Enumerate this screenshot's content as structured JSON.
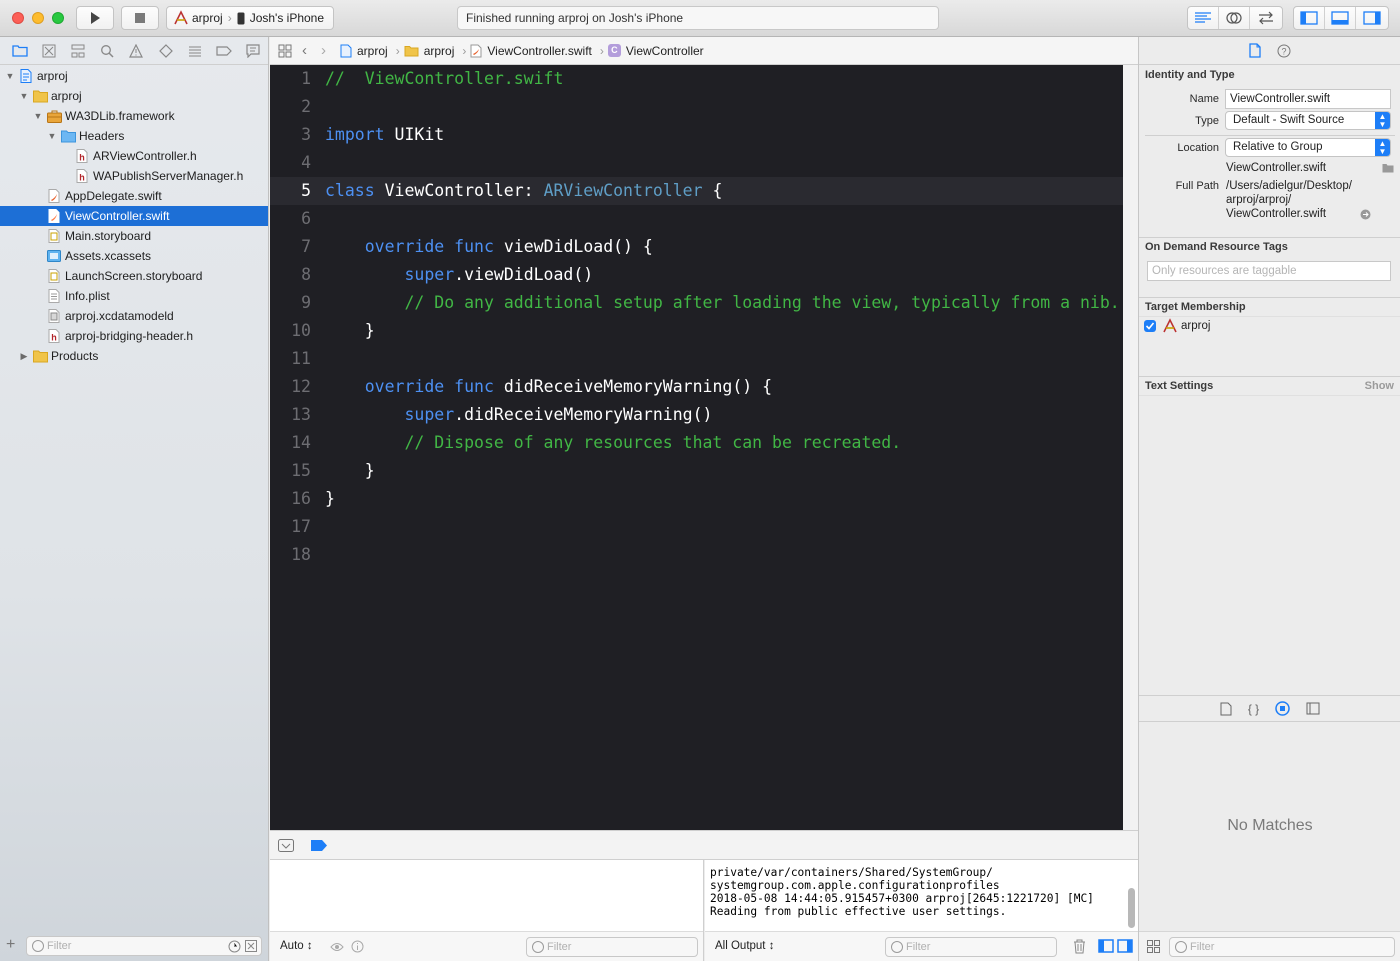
{
  "toolbar": {
    "scheme_name": "arproj",
    "device_name": "Josh's iPhone",
    "activity_status": "Finished running arproj on Josh's iPhone"
  },
  "navigator": {
    "tree": [
      {
        "label": "arproj",
        "icon": "project-icon",
        "level": 0,
        "disclosure": "open",
        "selected": false
      },
      {
        "label": "arproj",
        "icon": "folder-icon",
        "level": 1,
        "disclosure": "open",
        "selected": false
      },
      {
        "label": "WA3DLib.framework",
        "icon": "framework-icon",
        "level": 2,
        "disclosure": "open",
        "selected": false
      },
      {
        "label": "Headers",
        "icon": "blue-folder-icon",
        "level": 3,
        "disclosure": "open",
        "selected": false
      },
      {
        "label": "ARViewController.h",
        "icon": "header-file-icon",
        "level": 4,
        "disclosure": "none",
        "selected": false
      },
      {
        "label": "WAPublishServerManager.h",
        "icon": "header-file-icon",
        "level": 4,
        "disclosure": "none",
        "selected": false
      },
      {
        "label": "AppDelegate.swift",
        "icon": "swift-file-icon",
        "level": 2,
        "disclosure": "none",
        "selected": false
      },
      {
        "label": "ViewController.swift",
        "icon": "swift-file-icon",
        "level": 2,
        "disclosure": "none",
        "selected": true
      },
      {
        "label": "Main.storyboard",
        "icon": "storyboard-icon",
        "level": 2,
        "disclosure": "none",
        "selected": false
      },
      {
        "label": "Assets.xcassets",
        "icon": "assets-icon",
        "level": 2,
        "disclosure": "none",
        "selected": false
      },
      {
        "label": "LaunchScreen.storyboard",
        "icon": "storyboard-icon",
        "level": 2,
        "disclosure": "none",
        "selected": false
      },
      {
        "label": "Info.plist",
        "icon": "plist-icon",
        "level": 2,
        "disclosure": "none",
        "selected": false
      },
      {
        "label": "arproj.xcdatamodeld",
        "icon": "datamodel-icon",
        "level": 2,
        "disclosure": "none",
        "selected": false
      },
      {
        "label": "arproj-bridging-header.h",
        "icon": "header-file-icon",
        "level": 2,
        "disclosure": "none",
        "selected": false
      },
      {
        "label": "Products",
        "icon": "folder-icon",
        "level": 1,
        "disclosure": "closed",
        "selected": false
      }
    ],
    "filter_placeholder": "Filter"
  },
  "jumpbar": {
    "crumbs": [
      "arproj",
      "arproj",
      "ViewController.swift",
      "ViewController"
    ]
  },
  "editor": {
    "current_line": 5,
    "lines": [
      [
        [
          "c",
          "//  ViewController.swift"
        ]
      ],
      [],
      [
        [
          "k",
          "import"
        ],
        [
          "p",
          " UIKit"
        ]
      ],
      [],
      [
        [
          "k",
          "class"
        ],
        [
          "p",
          " ViewController: "
        ],
        [
          "t",
          "ARViewController"
        ],
        [
          "p",
          " {"
        ]
      ],
      [],
      [
        [
          "p",
          "    "
        ],
        [
          "k",
          "override"
        ],
        [
          "p",
          " "
        ],
        [
          "k",
          "func"
        ],
        [
          "p",
          " viewDidLoad() {"
        ]
      ],
      [
        [
          "p",
          "        "
        ],
        [
          "k",
          "super"
        ],
        [
          "p",
          ".viewDidLoad()"
        ]
      ],
      [
        [
          "p",
          "        "
        ],
        [
          "c",
          "// Do any additional setup after loading the view, typically from a nib."
        ]
      ],
      [
        [
          "p",
          "    }"
        ]
      ],
      [],
      [
        [
          "p",
          "    "
        ],
        [
          "k",
          "override"
        ],
        [
          "p",
          " "
        ],
        [
          "k",
          "func"
        ],
        [
          "p",
          " didReceiveMemoryWarning() {"
        ]
      ],
      [
        [
          "p",
          "        "
        ],
        [
          "k",
          "super"
        ],
        [
          "p",
          ".didReceiveMemoryWarning()"
        ]
      ],
      [
        [
          "p",
          "        "
        ],
        [
          "c",
          "// Dispose of any resources that can be recreated."
        ]
      ],
      [
        [
          "p",
          "    }"
        ]
      ],
      [
        [
          "p",
          "}"
        ]
      ],
      [],
      []
    ]
  },
  "debug": {
    "auto_label": "Auto ↕",
    "vars_filter_placeholder": "Filter",
    "console_lines": [
      "private/var/containers/Shared/SystemGroup/",
      "systemgroup.com.apple.configurationprofiles",
      "2018-05-08 14:44:05.915457+0300 arproj[2645:1221720] [MC]",
      "Reading from public effective user settings."
    ],
    "output_selector": "All Output ↕",
    "console_filter_placeholder": "Filter"
  },
  "inspector": {
    "identity_title": "Identity and Type",
    "name_label": "Name",
    "name_value": "ViewController.swift",
    "type_label": "Type",
    "type_value": "Default - Swift Source",
    "location_label": "Location",
    "location_value": "Relative to Group",
    "location_file": "ViewController.swift",
    "fullpath_label": "Full Path",
    "fullpath_lines": [
      "/Users/adielgur/Desktop/",
      "arproj/arproj/",
      "ViewController.swift"
    ],
    "odr_title": "On Demand Resource Tags",
    "odr_placeholder": "Only resources are taggable",
    "target_title": "Target Membership",
    "target_name": "arproj",
    "text_settings_title": "Text Settings",
    "text_settings_show": "Show",
    "no_matches": "No Matches",
    "library_filter_placeholder": "Filter"
  },
  "colors": {
    "selection": "#1d6fd6",
    "editor_bg": "#1f1f24",
    "comment": "#41b645",
    "keyword": "#4d90f2",
    "type": "#5f9ec6",
    "checkbox": "#1d7ef7"
  }
}
